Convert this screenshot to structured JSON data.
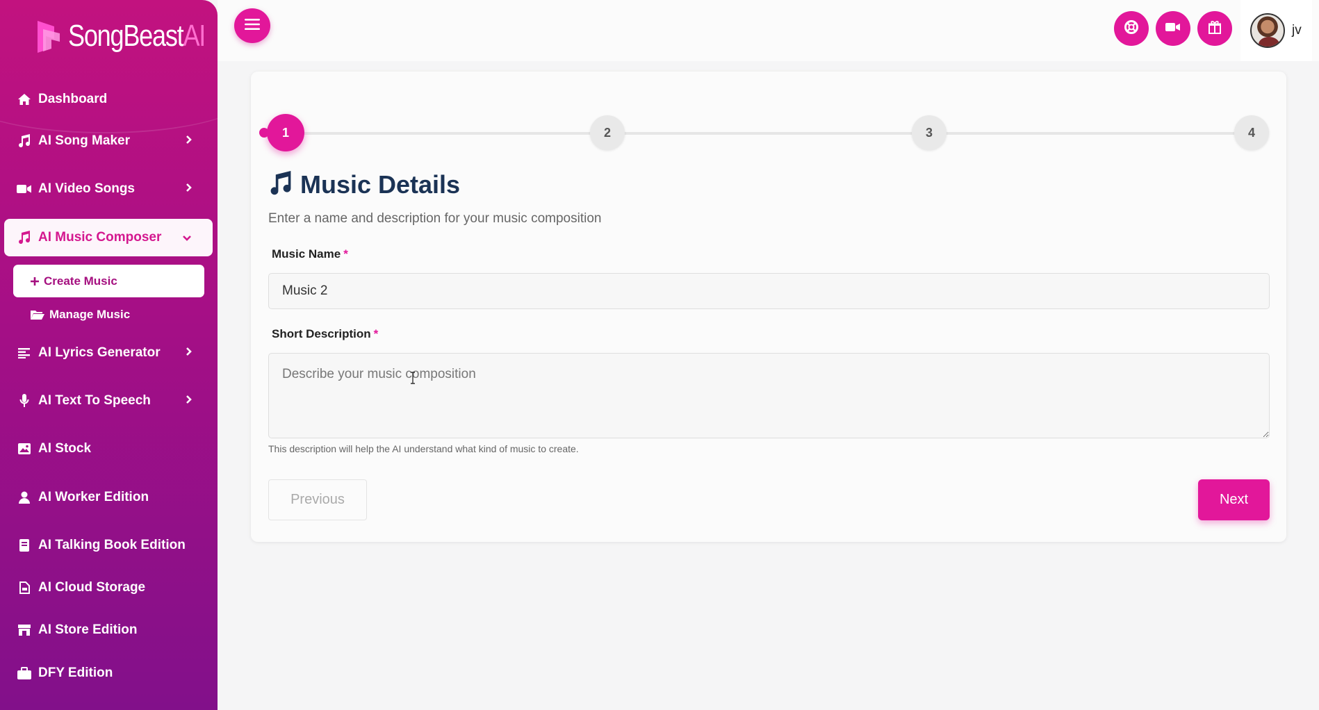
{
  "brand": {
    "name": "SongBeast",
    "suffix": "AI",
    "accent": "#e2179a"
  },
  "sidebar": {
    "items": [
      {
        "label": "Dashboard",
        "icon": "home-icon"
      },
      {
        "label": "AI Song Maker",
        "icon": "music-note-icon"
      },
      {
        "label": "AI Video Songs",
        "icon": "video-camera-icon"
      },
      {
        "label": "AI Music Composer",
        "icon": "music-note-icon"
      },
      {
        "label": "AI Lyrics Generator",
        "icon": "align-left-icon"
      },
      {
        "label": "AI Text To Speech",
        "icon": "microphone-icon"
      },
      {
        "label": "AI Stock",
        "icon": "image-icon"
      },
      {
        "label": "AI Worker Edition",
        "icon": "user-icon"
      },
      {
        "label": "AI Talking Book Edition",
        "icon": "book-icon"
      },
      {
        "label": "AI Cloud Storage",
        "icon": "file-icon"
      },
      {
        "label": "AI Store Edition",
        "icon": "store-icon"
      },
      {
        "label": "DFY Edition",
        "icon": "briefcase-icon"
      }
    ],
    "sub_items": [
      {
        "label": "Create Music",
        "icon": "plus-icon"
      },
      {
        "label": "Manage Music",
        "icon": "folder-open-icon"
      }
    ]
  },
  "topbar": {
    "buttons": [
      "support-icon",
      "video-icon",
      "gift-icon"
    ],
    "user_name": "jv"
  },
  "wizard": {
    "steps": [
      "1",
      "2",
      "3",
      "4"
    ],
    "current_step": 1,
    "title": "Music Details",
    "subtitle": "Enter a name and description for your music composition",
    "music_name_label": "Music Name",
    "music_name_value": "Music 2",
    "description_label": "Short Description",
    "description_placeholder": "Describe your music composition",
    "required_mark": "*",
    "help_text": "This description will help the AI understand what kind of music to create.",
    "previous_label": "Previous",
    "next_label": "Next"
  }
}
